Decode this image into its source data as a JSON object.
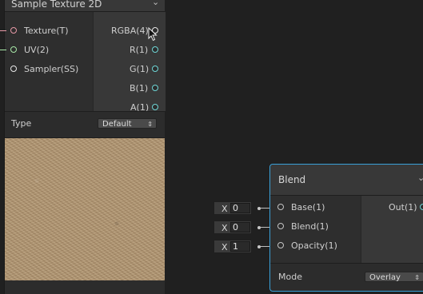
{
  "texture_node": {
    "title": "Sample Texture 2D",
    "inputs": [
      "Texture(T)",
      "UV(2)",
      "Sampler(SS)"
    ],
    "outputs": [
      "RGBA(4)",
      "R(1)",
      "G(1)",
      "B(1)",
      "A(1)"
    ],
    "type_label": "Type",
    "type_value": "Default",
    "dropdown_arrows": "⇕"
  },
  "blend_node": {
    "title": "Blend",
    "inputs": [
      "Base(1)",
      "Blend(1)",
      "Opacity(1)"
    ],
    "output": "Out(1)",
    "mode_label": "Mode",
    "mode_value": "Overlay",
    "dropdown_arrows": "⇕"
  },
  "inline_values": [
    {
      "axis": "X",
      "value": "0"
    },
    {
      "axis": "X",
      "value": "0"
    },
    {
      "axis": "X",
      "value": "1"
    }
  ],
  "icons": {
    "collapse": "chevron-down-icon",
    "cursor": "mouse-pointer-icon"
  },
  "colors": {
    "background": "#202020",
    "selection": "#3aa0d8",
    "texture_port": "#e79aa7",
    "vector_port": "#a8e8a8",
    "float_port": "#6fd6d6"
  }
}
